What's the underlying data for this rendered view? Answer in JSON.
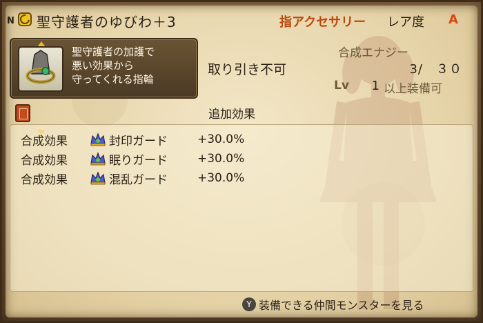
{
  "header": {
    "rank": "N",
    "title": "聖守護者のゆびわ＋3",
    "category": "指アクセサリー",
    "rarity_label": "レア度",
    "rarity_value": "A"
  },
  "description": {
    "lines": [
      "聖守護者の加護で",
      "悪い効果から",
      "守ってくれる指輪"
    ]
  },
  "trade_status": "取り引き不可",
  "synthesis": {
    "label": "合成エナジー",
    "value": "3/　３０"
  },
  "level": {
    "label": "Lv",
    "value": "1",
    "suffix": "以上装備可"
  },
  "effects": {
    "title": "追加効果",
    "rows": [
      {
        "type": "合成効果",
        "name": "封印ガード",
        "value": "+30.0%"
      },
      {
        "type": "合成効果",
        "name": "眠りガード",
        "value": "+30.0%"
      },
      {
        "type": "合成効果",
        "name": "混乱ガード",
        "value": "+30.0%"
      }
    ]
  },
  "footer": {
    "button": "Y",
    "text": "装備できる仲間モンスターを見る"
  }
}
